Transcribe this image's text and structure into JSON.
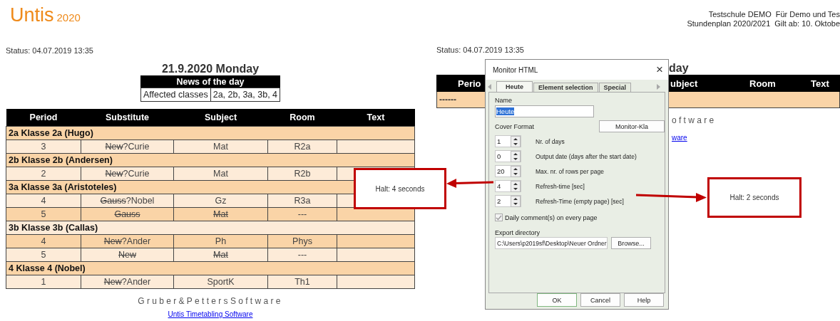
{
  "left_page": {
    "logo": {
      "name": "Untis",
      "year": "2020"
    },
    "status": "Status: 04.07.2019 13:35",
    "date_heading": "21.9.2020 Monday",
    "news": {
      "title": "News of the day",
      "label": "Affected classes",
      "value": "2a, 2b, 3a, 3b, 4"
    },
    "table": {
      "columns": [
        "Period",
        "Substitute",
        "Subject",
        "Room",
        "Text"
      ],
      "groups": [
        {
          "title": "2a Klasse 2a (Hugo)",
          "rows": [
            {
              "period": "3",
              "substitute": {
                "struck": "New",
                "text": "?Curie"
              },
              "subject": {
                "text": "Mat",
                "struck": false
              },
              "room": "R2a"
            }
          ]
        },
        {
          "title": "2b Klasse 2b (Andersen)",
          "rows": [
            {
              "period": "2",
              "substitute": {
                "struck": "New",
                "text": "?Curie"
              },
              "subject": {
                "text": "Mat",
                "struck": false
              },
              "room": "R2b"
            }
          ]
        },
        {
          "title": "3a Klasse 3a (Aristoteles)",
          "rows": [
            {
              "period": "4",
              "substitute": {
                "struck": "Gauss",
                "text": "?Nobel"
              },
              "subject": {
                "text": "Gz",
                "struck": false
              },
              "room": "R3a"
            },
            {
              "period": "5",
              "substitute": {
                "struck": "Gauss"
              },
              "subject": {
                "text": "Mat",
                "struck": true
              },
              "room": "---"
            }
          ]
        },
        {
          "title": "3b Klasse 3b (Callas)",
          "rows": [
            {
              "period": "4",
              "substitute": {
                "struck": "New",
                "text": "?Ander"
              },
              "subject": {
                "text": "Ph",
                "struck": false
              },
              "room": "Phys"
            },
            {
              "period": "5",
              "substitute": {
                "struck": "New"
              },
              "subject": {
                "text": "Mat",
                "struck": true
              },
              "room": "---"
            }
          ]
        },
        {
          "title": "4 Klasse 4 (Nobel)",
          "rows": [
            {
              "period": "1",
              "substitute": {
                "struck": "New",
                "text": "?Ander"
              },
              "subject": {
                "text": "SportK",
                "struck": false
              },
              "room": "Th1"
            }
          ]
        }
      ]
    },
    "footer": "Gruber&PettersSoftware",
    "link": "Untis Timetabling Software"
  },
  "right_page": {
    "school": "Testschule DEMO",
    "school_note": "Für Demo und Tes",
    "plan": "Stundenplan 2020/2021",
    "valid": "Gilt ab: 10. Oktobe",
    "status": "Status: 04.07.2019 13:35",
    "date_heading": "day",
    "table": {
      "columns": [
        "Perio",
        "ubject",
        "Room",
        "Text"
      ],
      "rows": [
        {
          "text": "------"
        }
      ]
    },
    "footer": "oftware",
    "link": "ware"
  },
  "dialog": {
    "title": "Monitor HTML",
    "close": "×",
    "tabs": [
      {
        "label": "Heute",
        "selected": true
      },
      {
        "label": "Element selection",
        "selected": false
      },
      {
        "label": "Special",
        "selected": false
      }
    ],
    "name_label": "Name",
    "name_field": {
      "value": "Heute",
      "selected": true
    },
    "cover_format": "Cover Format",
    "monitor_button": "Monitor-Kla",
    "spinners": [
      {
        "value": "1",
        "label": "Nr. of days"
      },
      {
        "value": "0",
        "label": "Output date (days after the start date)"
      },
      {
        "value": "20",
        "label": "Max. nr. of rows per page"
      },
      {
        "value": "4",
        "label": "Refresh-time [sec]"
      },
      {
        "value": "2",
        "label": "Refresh-Time (empty page) [sec]"
      }
    ],
    "checkbox": {
      "label": "Daily comment(s) on every page",
      "checked": true,
      "disabled": true
    },
    "export_label": "Export directory",
    "export_value": "C:\\Users\\p2019sf\\Desktop\\Neuer Ordner",
    "browse": "Browse...",
    "buttons": [
      "OK",
      "Cancel",
      "Help"
    ]
  },
  "callouts": [
    {
      "text": "Halt: 4 seconds"
    },
    {
      "text": "Halt: 2 seconds"
    }
  ]
}
